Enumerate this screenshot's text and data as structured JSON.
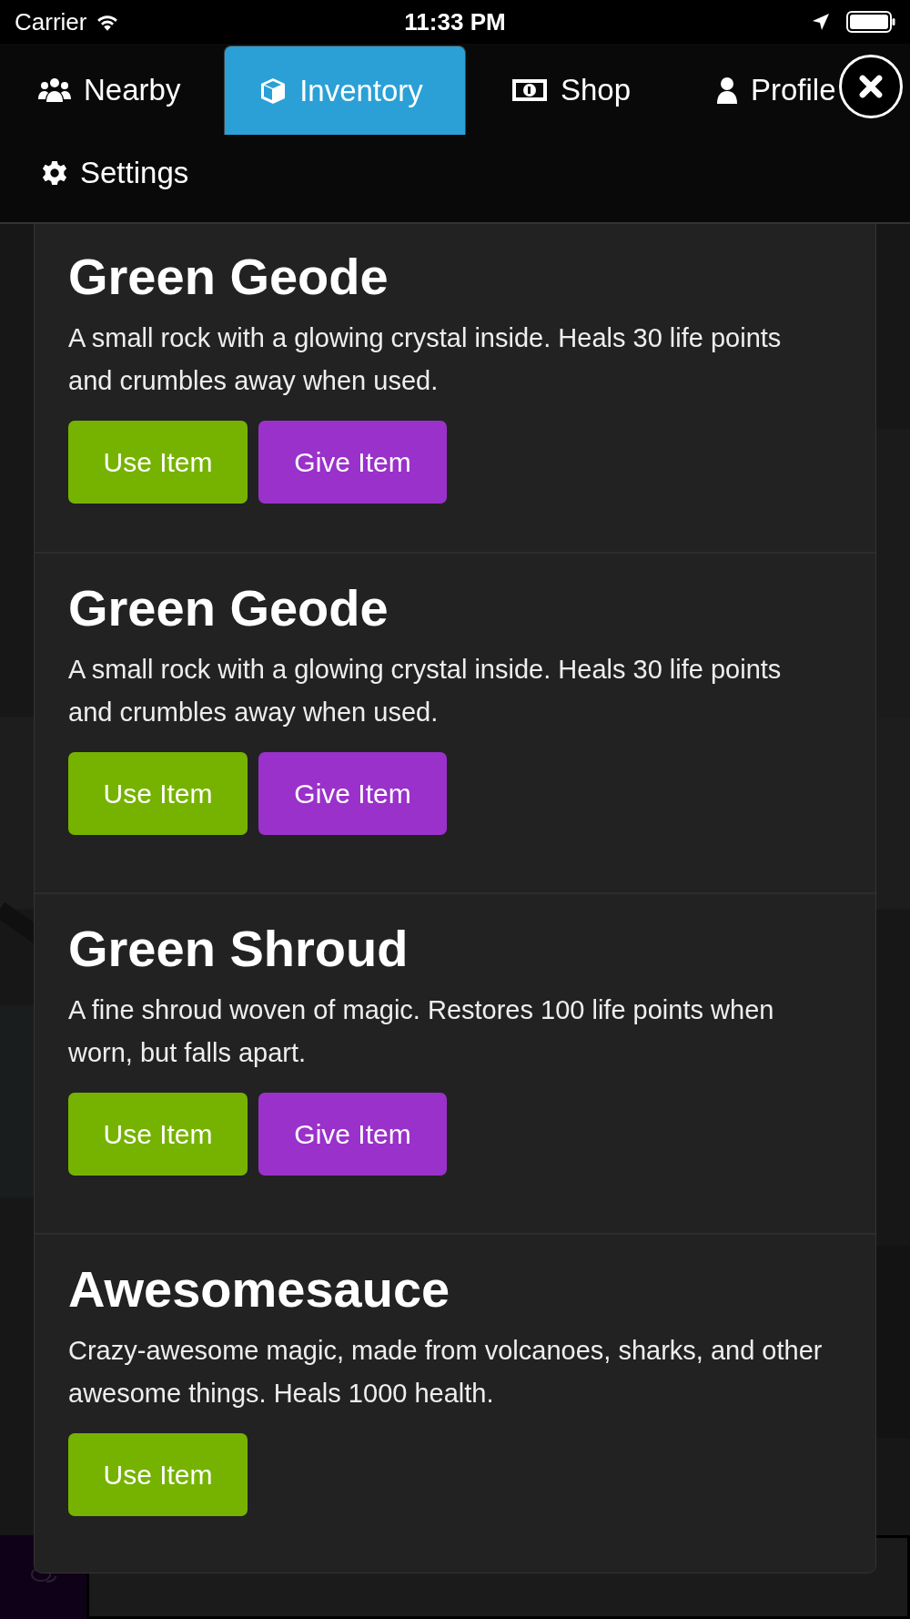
{
  "status_bar": {
    "carrier": "Carrier",
    "time": "11:33 PM"
  },
  "tabs": [
    {
      "label": "Nearby",
      "selected": false
    },
    {
      "label": "Inventory",
      "selected": true
    },
    {
      "label": "Shop",
      "selected": false
    },
    {
      "label": "Profile",
      "selected": false
    },
    {
      "label": "Settings",
      "selected": false
    }
  ],
  "items": [
    {
      "title": "Green Geode",
      "description": "A small rock with a glowing crystal inside. Heals 30 life points and crumbles away when used.",
      "buttons": [
        {
          "label": "Use Item",
          "kind": "use"
        },
        {
          "label": "Give Item",
          "kind": "give"
        }
      ]
    },
    {
      "title": "Green Geode",
      "description": "A small rock with a glowing crystal inside. Heals 30 life points and crumbles away when used.",
      "buttons": [
        {
          "label": "Use Item",
          "kind": "use"
        },
        {
          "label": "Give Item",
          "kind": "give"
        }
      ]
    },
    {
      "title": "Green Shroud",
      "description": "A fine shroud woven of magic. Restores 100 life points when worn, but falls apart.",
      "buttons": [
        {
          "label": "Use Item",
          "kind": "use"
        },
        {
          "label": "Give Item",
          "kind": "give"
        }
      ]
    },
    {
      "title": "Awesomesauce",
      "description": "Crazy-awesome magic, made from volcanoes, sharks, and other awesome things. Heals 1000 health.",
      "buttons": [
        {
          "label": "Use Item",
          "kind": "use"
        }
      ]
    }
  ],
  "chat": {
    "kind": "field"
  }
}
